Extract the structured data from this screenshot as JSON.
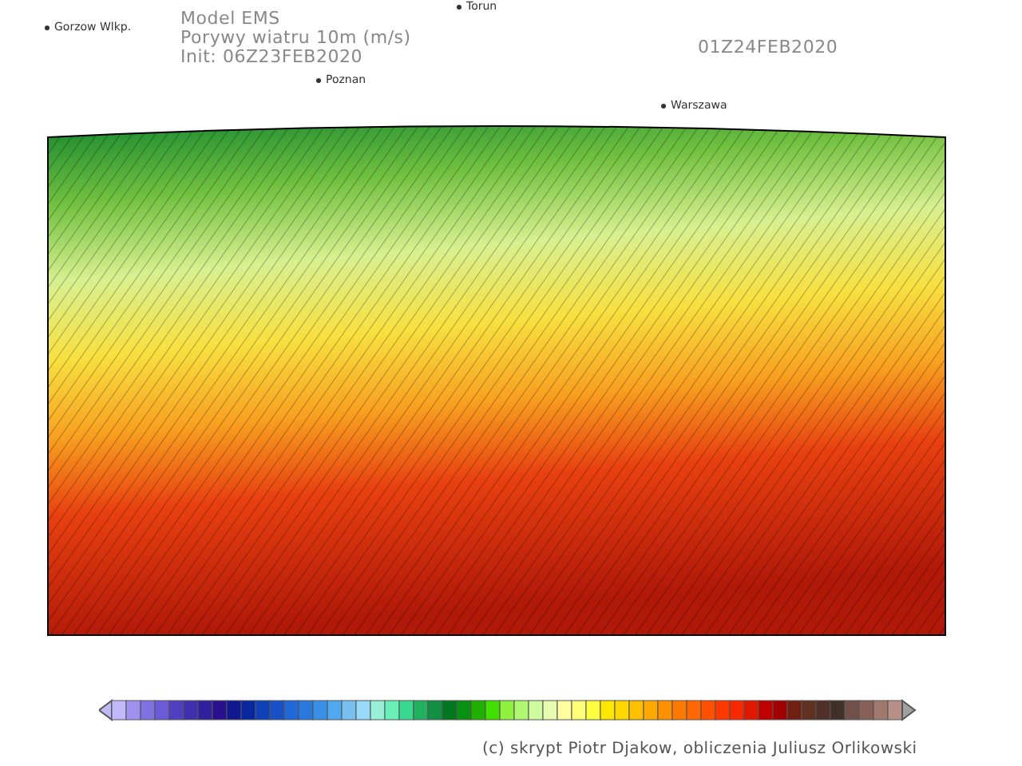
{
  "header": {
    "model": "Model EMS",
    "title": "Porywy wiatru 10m (m/s)",
    "init": "Init: 06Z23FEB2020",
    "valid_time": "01Z24FEB2020"
  },
  "cities": [
    {
      "name": "Torun"
    },
    {
      "name": "Gorzow Wlkp."
    },
    {
      "name": "Poznan"
    },
    {
      "name": "Warszawa"
    }
  ],
  "credit": "(c) skrypt Piotr Djakow, obliczenia Juliusz Orlikowski"
}
